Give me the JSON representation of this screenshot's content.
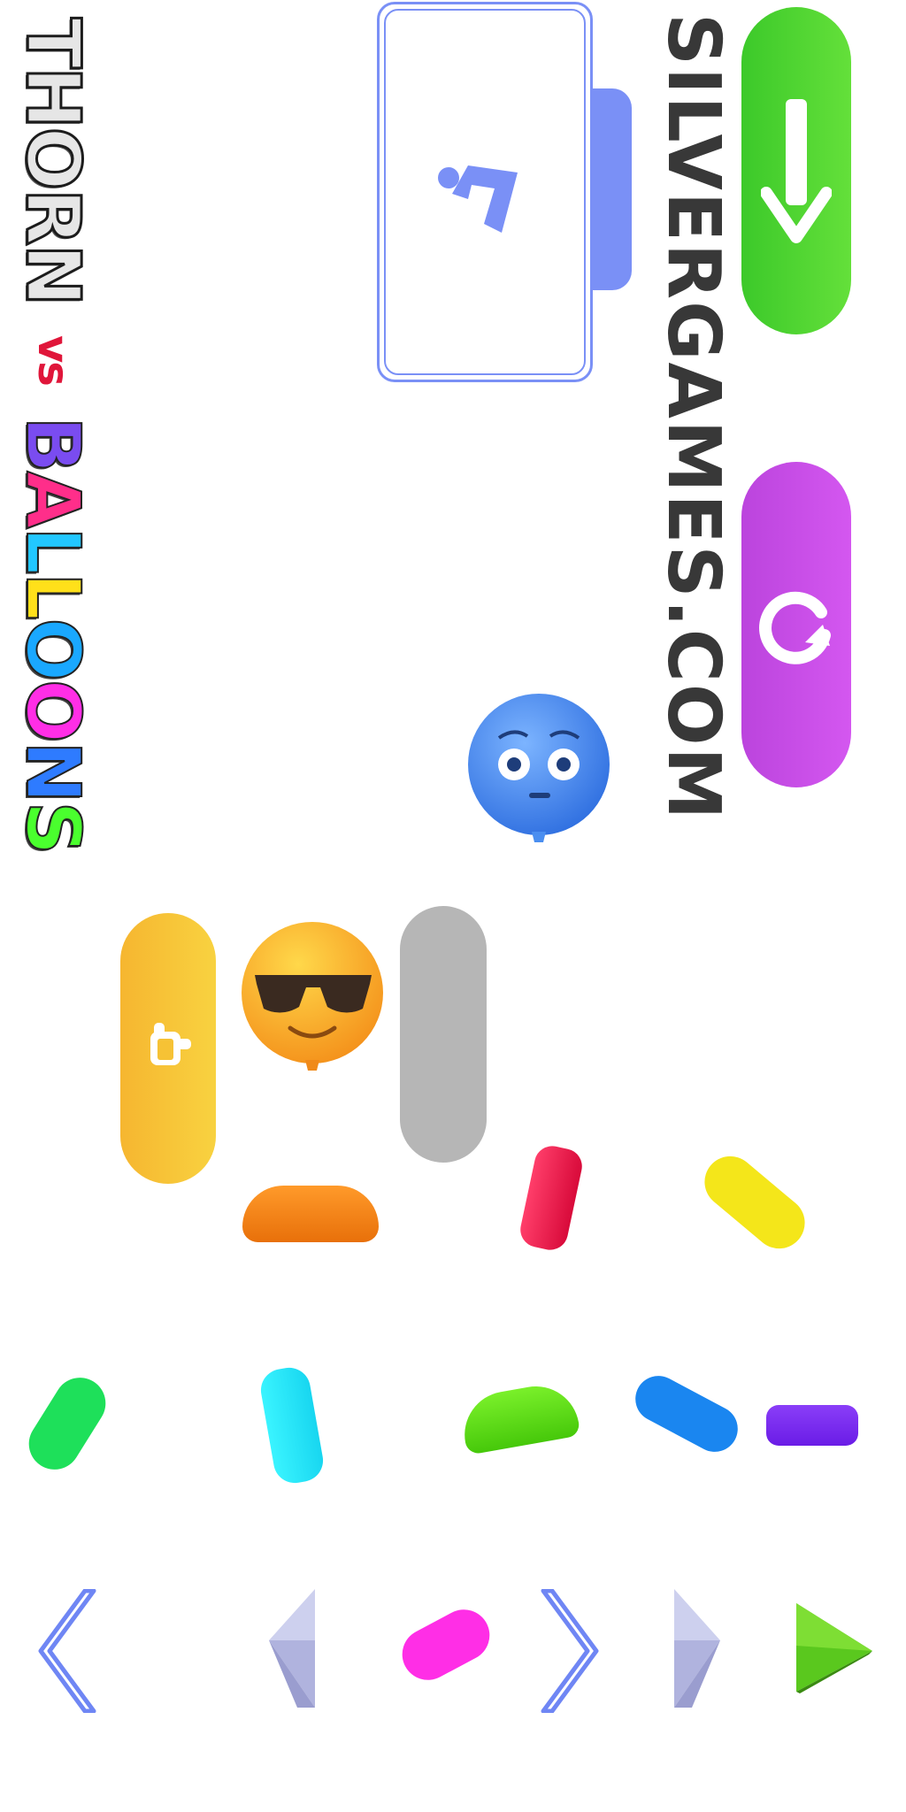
{
  "logo": {
    "thorn": "THORN",
    "vs": "vs",
    "balloons_letters": [
      "B",
      "A",
      "L",
      "L",
      "O",
      "O",
      "N",
      "S"
    ],
    "balloons_colors": [
      "#7a4cf0",
      "#ff2e8a",
      "#22c7ff",
      "#ffe01a",
      "#1aa8ff",
      "#ff2ee6",
      "#2e7bff",
      "#4aff2e"
    ]
  },
  "site": {
    "title": "SILVERGAMES.COM"
  },
  "icons": {
    "download": "arrow-down-icon",
    "restart": "restart-icon",
    "hint": "question-icon",
    "pointer": "pointer-hand-icon",
    "prev_fast": "double-chevron-left-icon",
    "prev": "chevron-left-icon",
    "next_fast": "double-chevron-right-icon",
    "next": "chevron-right-icon",
    "play": "play-icon"
  },
  "colors": {
    "green_button": "#49d42e",
    "purple_button": "#c84ae6",
    "orange_button": "#f8c23a",
    "gray_button": "#b6b6b6",
    "hint_accent": "#7a90f6",
    "balloon_blue": "#3f86f0",
    "play_green": "#57c71e"
  }
}
